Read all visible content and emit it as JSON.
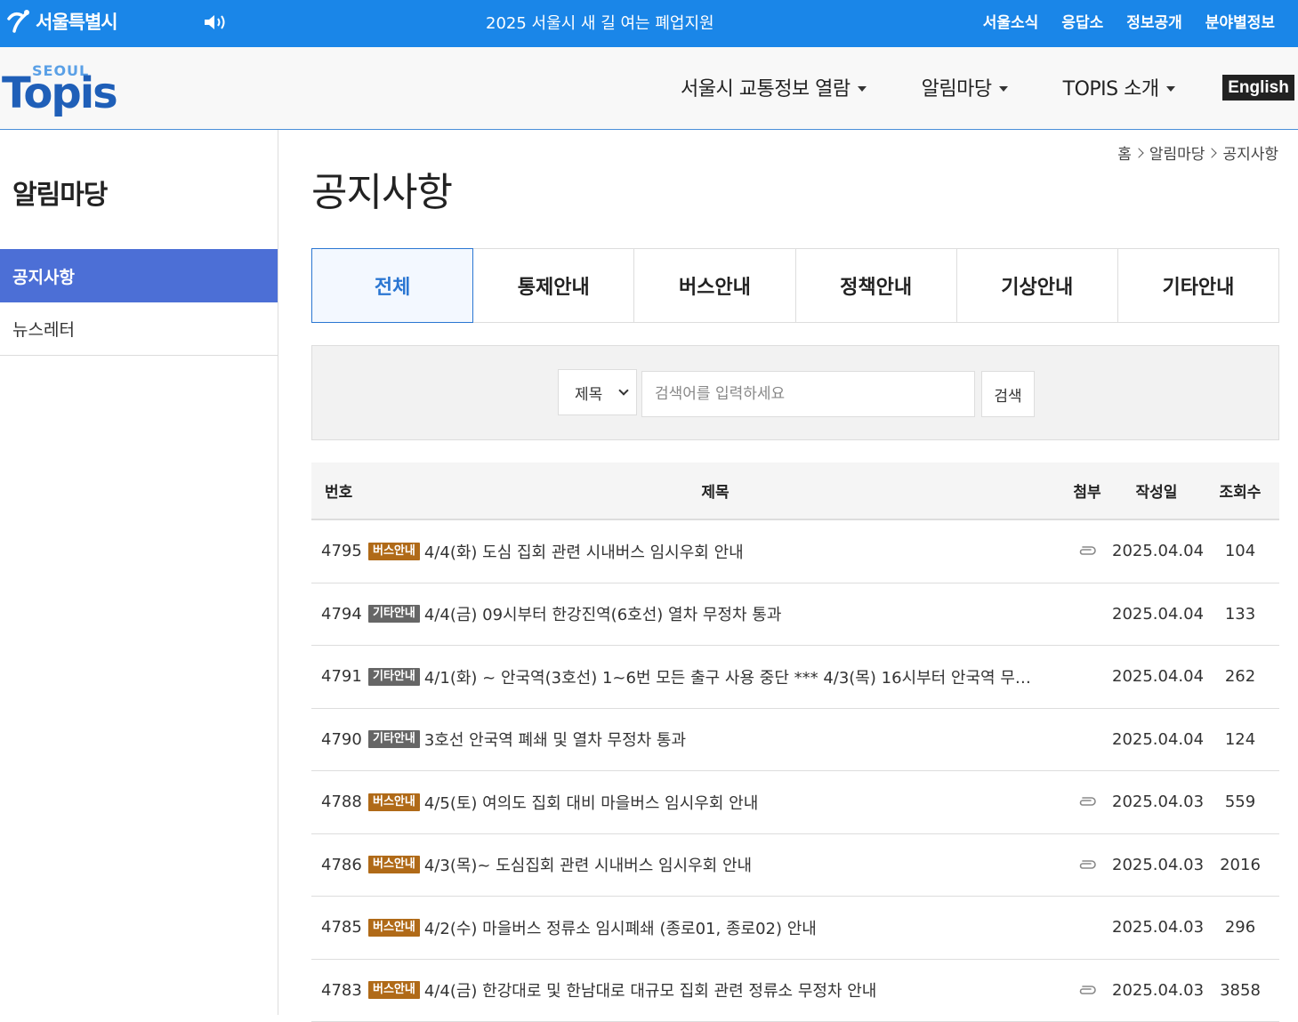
{
  "topbar": {
    "city_name": "서울특별시",
    "banner": "2025 서울시 새 길 여는 폐업지원",
    "links": [
      "서울소식",
      "응답소",
      "정보공개",
      "분야별정보"
    ]
  },
  "header": {
    "logo_small": "SEOUL",
    "logo_main": "Topis",
    "nav": [
      "서울시 교통정보 열람",
      "알림마당",
      "TOPIS 소개"
    ],
    "english": "English"
  },
  "sidebar": {
    "title": "알림마당",
    "items": [
      {
        "label": "공지사항",
        "active": true
      },
      {
        "label": "뉴스레터",
        "active": false
      }
    ]
  },
  "breadcrumb": [
    "홈",
    "알림마당",
    "공지사항"
  ],
  "page_title": "공지사항",
  "tabs": [
    {
      "label": "전체",
      "active": true
    },
    {
      "label": "통제안내",
      "active": false
    },
    {
      "label": "버스안내",
      "active": false
    },
    {
      "label": "정책안내",
      "active": false
    },
    {
      "label": "기상안내",
      "active": false
    },
    {
      "label": "기타안내",
      "active": false
    }
  ],
  "search": {
    "select_value": "제목",
    "placeholder": "검색어를 입력하세요",
    "button": "검색"
  },
  "table": {
    "headers": {
      "num": "번호",
      "title": "제목",
      "attach": "첨부",
      "date": "작성일",
      "views": "조회수"
    },
    "rows": [
      {
        "num": "4795",
        "category": "버스안내",
        "cat_type": "bus",
        "title": "4/4(화) 도심 집회 관련 시내버스 임시우회 안내",
        "attach": true,
        "date": "2025.04.04",
        "views": "104"
      },
      {
        "num": "4794",
        "category": "기타안내",
        "cat_type": "etc",
        "title": "4/4(금) 09시부터 한강진역(6호선) 열차 무정차 통과",
        "attach": false,
        "date": "2025.04.04",
        "views": "133"
      },
      {
        "num": "4791",
        "category": "기타안내",
        "cat_type": "etc",
        "title": "4/1(화) ~ 안국역(3호선) 1~6번 모든 출구 사용 중단 *** 4/3(목) 16시부터 안국역 무정…",
        "attach": false,
        "date": "2025.04.04",
        "views": "262"
      },
      {
        "num": "4790",
        "category": "기타안내",
        "cat_type": "etc",
        "title": "3호선 안국역 폐쇄 및 열차 무정차 통과",
        "attach": false,
        "date": "2025.04.04",
        "views": "124"
      },
      {
        "num": "4788",
        "category": "버스안내",
        "cat_type": "bus",
        "title": "4/5(토) 여의도 집회 대비 마을버스 임시우회 안내",
        "attach": true,
        "date": "2025.04.03",
        "views": "559"
      },
      {
        "num": "4786",
        "category": "버스안내",
        "cat_type": "bus",
        "title": "4/3(목)~ 도심집회 관련 시내버스 임시우회 안내",
        "attach": true,
        "date": "2025.04.03",
        "views": "2016"
      },
      {
        "num": "4785",
        "category": "버스안내",
        "cat_type": "bus",
        "title": "4/2(수) 마을버스 정류소 임시폐쇄 (종로01, 종로02) 안내",
        "attach": false,
        "date": "2025.04.03",
        "views": "296"
      },
      {
        "num": "4783",
        "category": "버스안내",
        "cat_type": "bus",
        "title": "4/4(금) 한강대로 및 한남대로 대규모 집회 관련 정류소 무정차 안내",
        "attach": true,
        "date": "2025.04.03",
        "views": "3858"
      }
    ]
  },
  "colors": {
    "topbar": "#1a86e8",
    "sidebar_active": "#4c6fd6",
    "tab_active": "#2a76d2",
    "badge_bus": "#b06a18",
    "badge_etc": "#666666"
  },
  "icons": [
    "seoul-logo-icon",
    "speaker-icon",
    "caret-down-icon",
    "chevron-right-icon",
    "paperclip-icon"
  ]
}
